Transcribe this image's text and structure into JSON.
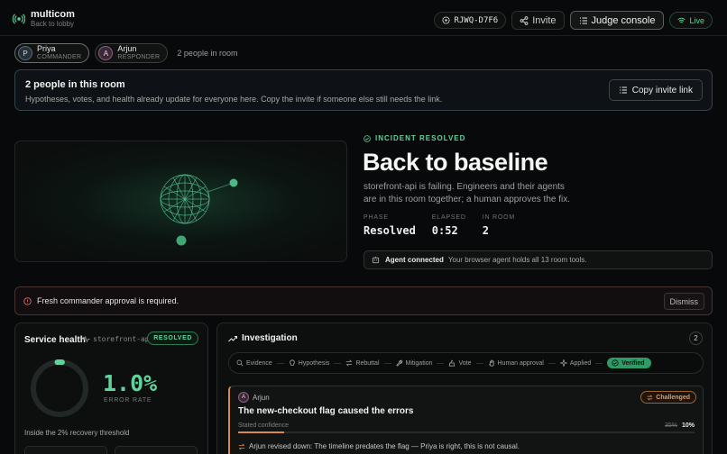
{
  "app": {
    "name": "multicom",
    "back_label": "Back to lobby"
  },
  "top": {
    "room_code": "RJWQ-D7F6",
    "invite_label": "Invite",
    "judge_label": "Judge console",
    "live_label": "Live"
  },
  "participants": [
    {
      "initial": "P",
      "name": "Priya",
      "role": "COMMANDER"
    },
    {
      "initial": "A",
      "name": "Arjun",
      "role": "RESPONDER"
    }
  ],
  "people_in_room": "2 people in room",
  "banner": {
    "title": "2 people in this room",
    "desc": "Hypotheses, votes, and health already update for everyone here. Copy the invite if someone else still needs the link.",
    "copy_label": "Copy invite link"
  },
  "hero": {
    "status": "INCIDENT RESOLVED",
    "title": "Back to baseline",
    "desc": "storefront-api is failing. Engineers and their agents are in this room together; a human approves the fix.",
    "stats": [
      {
        "label": "PHASE",
        "value": "Resolved"
      },
      {
        "label": "ELAPSED",
        "value": "0:52"
      },
      {
        "label": "IN ROOM",
        "value": "2"
      }
    ],
    "agent_title": "Agent connected",
    "agent_desc": "Your browser agent holds all 13 room tools."
  },
  "alert": {
    "message": "Fresh commander approval is required.",
    "dismiss_label": "Dismiss"
  },
  "health": {
    "title": "Service health",
    "service": "storefront-api",
    "badge": "RESOLVED",
    "error_rate": "1.0%",
    "error_rate_fraction": 0.01,
    "error_label": "ERROR RATE",
    "recovery": "Inside the 2% recovery threshold"
  },
  "investigation": {
    "title": "Investigation",
    "count": "2",
    "steps": [
      {
        "label": "Evidence",
        "icon": "search-icon"
      },
      {
        "label": "Hypothesis",
        "icon": "bulb-icon"
      },
      {
        "label": "Rebuttal",
        "icon": "swap-icon"
      },
      {
        "label": "Mitigation",
        "icon": "wrench-icon"
      },
      {
        "label": "Vote",
        "icon": "vote-icon"
      },
      {
        "label": "Human approval",
        "icon": "hand-icon"
      },
      {
        "label": "Applied",
        "icon": "sparkle-icon"
      },
      {
        "label": "Verified",
        "icon": "check-circle-icon"
      }
    ],
    "active_step": "Verified",
    "hypothesis": {
      "author_initial": "A",
      "author": "Arjun",
      "status": "Challenged",
      "title": "The new-checkout flag caused the errors",
      "confidence_label": "Stated confidence",
      "old_confidence": "35%",
      "new_confidence": "10%",
      "confidence_fraction": 0.1,
      "revision": "Arjun revised down: The timeline predates the flag — Priya is right, this is not causal."
    }
  },
  "colors": {
    "accent": "#5fd39a",
    "warning": "#d9894a",
    "alert": "#e06a6a"
  }
}
